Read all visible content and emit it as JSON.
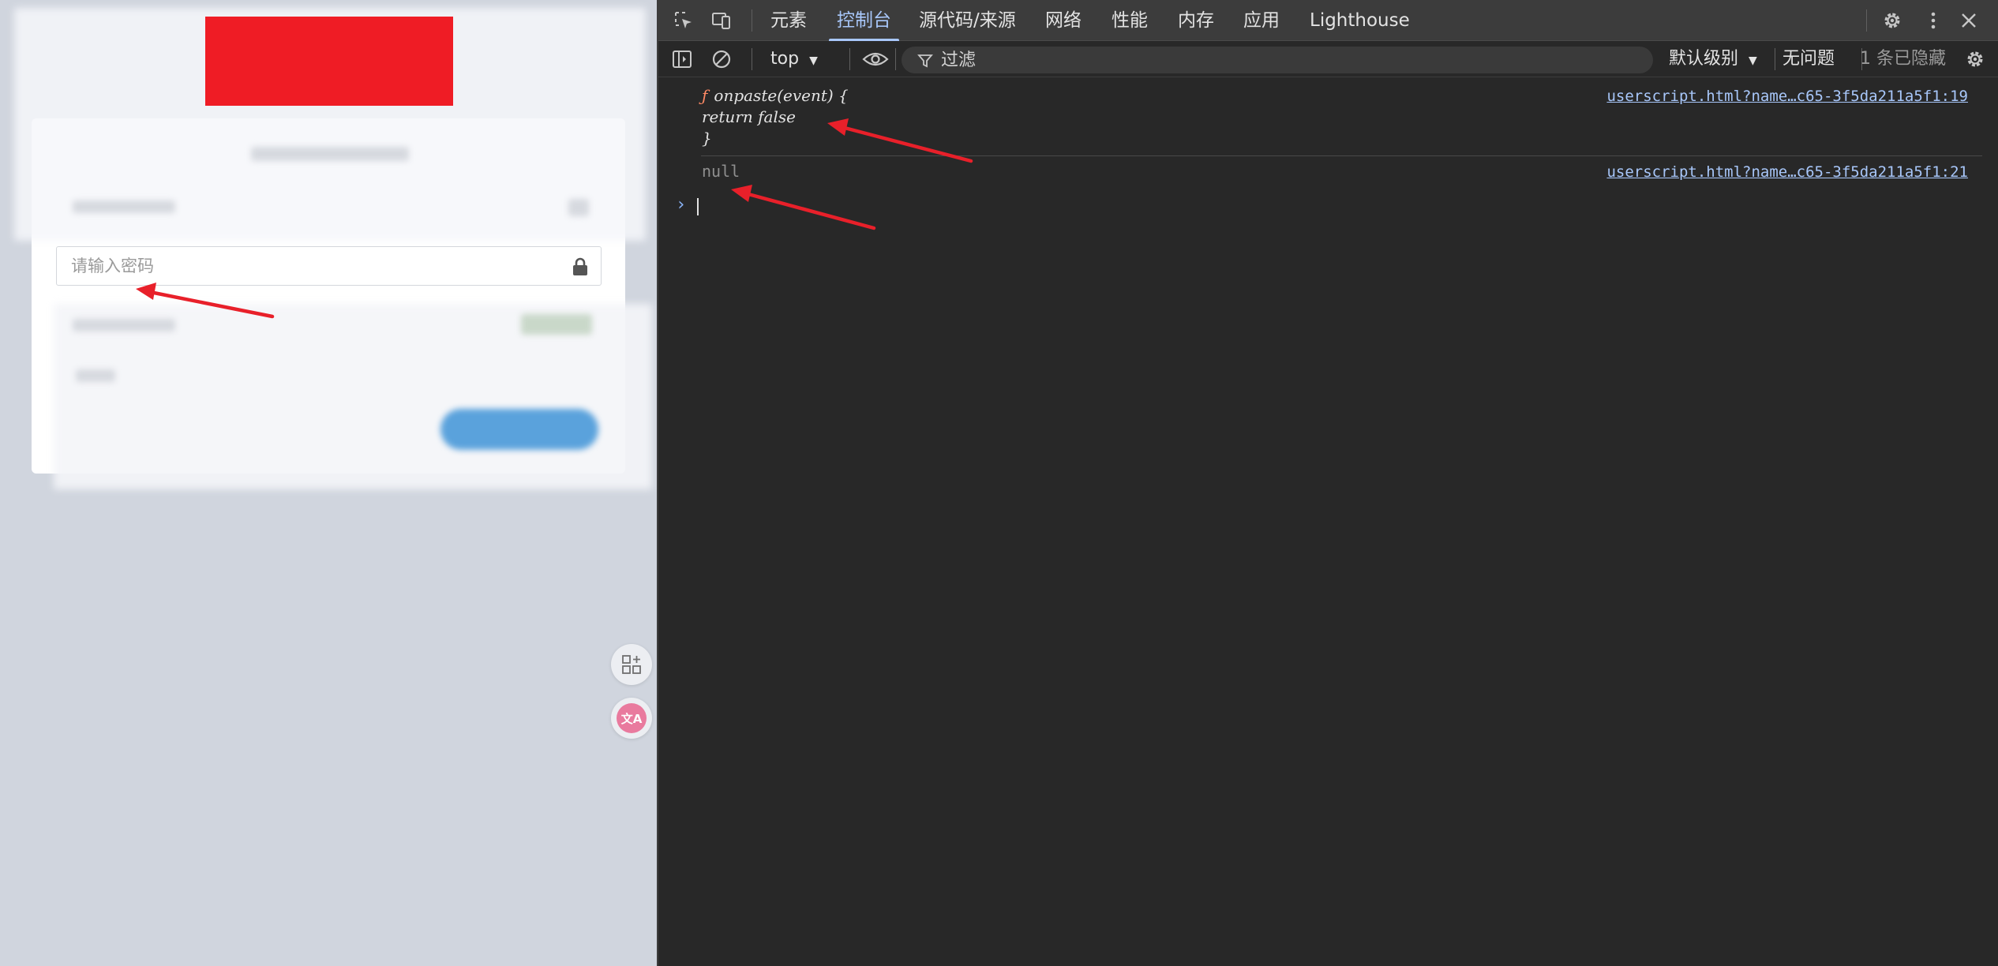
{
  "page": {
    "password_placeholder": "请输入密码",
    "logo_color": "#ef1c25",
    "float_apps_icon": "apps-add-icon",
    "translate_badge": "文A"
  },
  "devtools": {
    "tabs": [
      "元素",
      "控制台",
      "源代码/来源",
      "网络",
      "性能",
      "内存",
      "应用",
      "Lighthouse"
    ],
    "active_tab": "控制台",
    "toolbar": {
      "context": "top",
      "filter_placeholder": "过滤",
      "level": "默认级别",
      "issues": "无问题",
      "hidden": "1 条已隐藏"
    },
    "console": {
      "entry1": {
        "f": "ƒ",
        "line1": "onpaste(event) {",
        "line2": "return false",
        "line3": "}",
        "source": "userscript.html?name…c65-3f5da211a5f1:19"
      },
      "entry2": {
        "value": "null",
        "source": "userscript.html?name…c65-3f5da211a5f1:21"
      },
      "prompt": "›"
    }
  },
  "annotation_color": "#e8202a"
}
